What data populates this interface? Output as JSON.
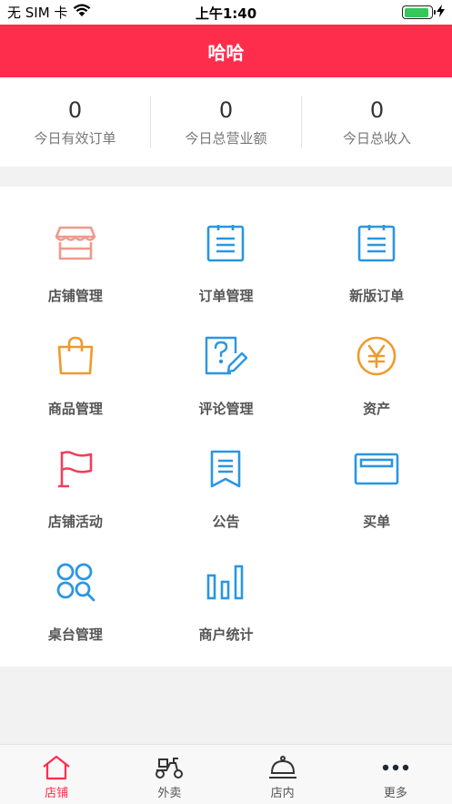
{
  "status_bar": {
    "carrier": "无 SIM 卡",
    "time": "上午1:40",
    "battery_fill": 0.9
  },
  "header": {
    "title": "哈哈"
  },
  "stats": [
    {
      "value": "0",
      "label": "今日有效订单"
    },
    {
      "value": "0",
      "label": "今日总营业额"
    },
    {
      "value": "0",
      "label": "今日总收入"
    }
  ],
  "menu": [
    {
      "label": "店铺管理",
      "icon": "store-icon",
      "color": "#f0998c"
    },
    {
      "label": "订单管理",
      "icon": "order-list-icon",
      "color": "#2b96e2"
    },
    {
      "label": "新版订单",
      "icon": "new-order-icon",
      "color": "#2b96e2"
    },
    {
      "label": "商品管理",
      "icon": "shopping-bag-icon",
      "color": "#ef9a2e"
    },
    {
      "label": "评论管理",
      "icon": "review-edit-icon",
      "color": "#2b96e2"
    },
    {
      "label": "资产",
      "icon": "yen-coin-icon",
      "color": "#ef9a2e"
    },
    {
      "label": "店铺活动",
      "icon": "flag-icon",
      "color": "#f0405a"
    },
    {
      "label": "公告",
      "icon": "announcement-icon",
      "color": "#2b96e2"
    },
    {
      "label": "买单",
      "icon": "card-icon",
      "color": "#2b96e2"
    },
    {
      "label": "桌台管理",
      "icon": "table-grid-icon",
      "color": "#2b96e2"
    },
    {
      "label": "商户统计",
      "icon": "bar-chart-icon",
      "color": "#2b96e2"
    }
  ],
  "tabs": [
    {
      "label": "店铺",
      "icon": "home-icon",
      "active": true
    },
    {
      "label": "外卖",
      "icon": "scooter-icon",
      "active": false
    },
    {
      "label": "店内",
      "icon": "cloche-icon",
      "active": false
    },
    {
      "label": "更多",
      "icon": "more-dots-icon",
      "active": false
    }
  ],
  "colors": {
    "accent": "#ff2d4c",
    "blue": "#2b96e2",
    "orange": "#ef9a2e",
    "pink": "#f0998c"
  }
}
